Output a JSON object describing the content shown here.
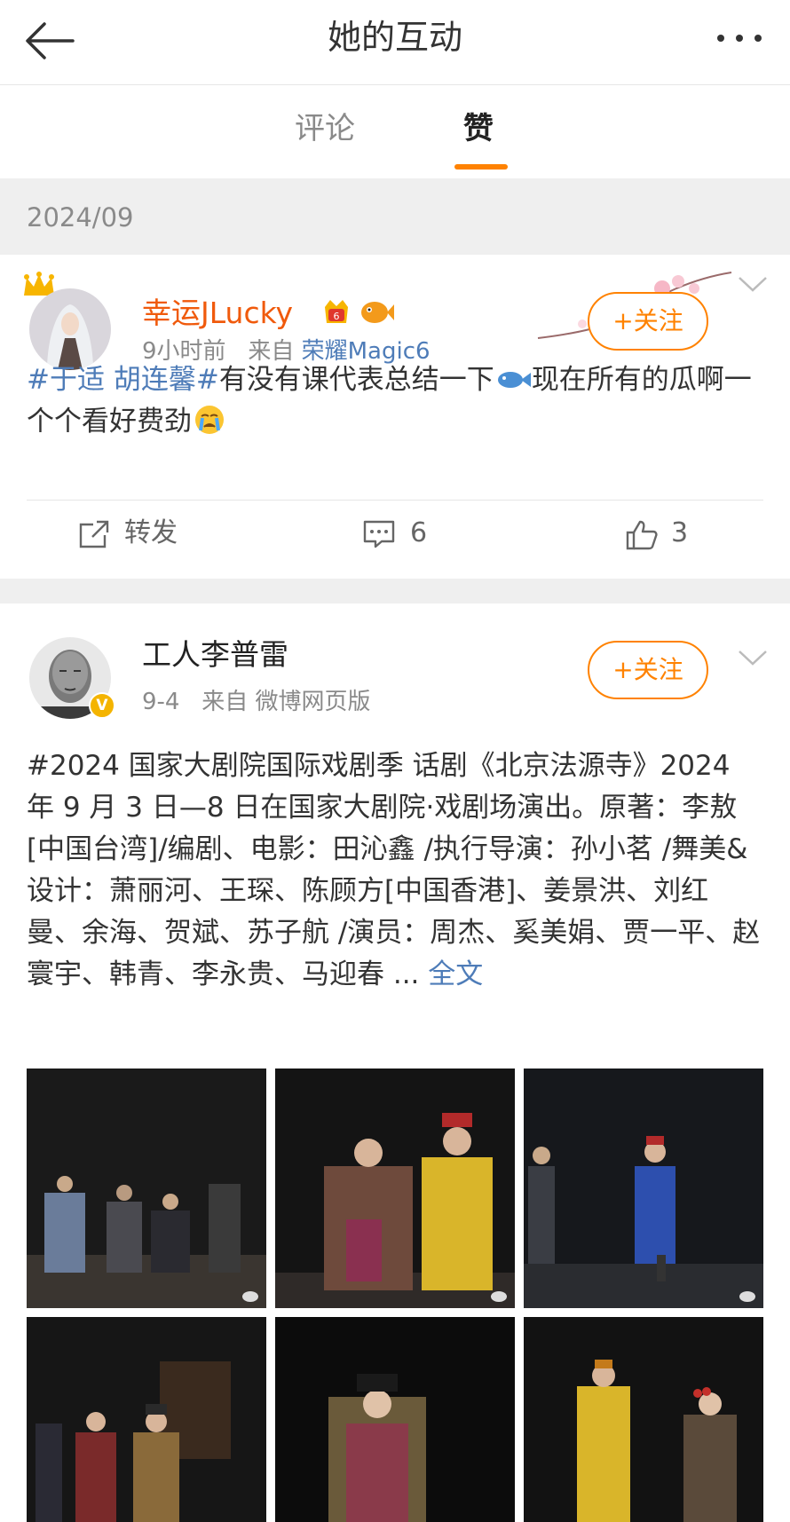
{
  "header": {
    "title": "她的互动"
  },
  "tabs": [
    {
      "label": "评论"
    },
    {
      "label": "赞"
    }
  ],
  "month": "2024/09",
  "posts": [
    {
      "username": "幸运JLucky",
      "time": "9小时前",
      "source_prefix": "来自",
      "device": "荣耀Magic6",
      "follow_label": "+关注",
      "hashtag": "#于适 胡连馨#",
      "text": "有没有课代表总结一下",
      "text2": "现在所有的瓜啊一个个看好费劲",
      "actions": {
        "repost_label": "转发",
        "comment_count": "6",
        "like_count": "3"
      }
    },
    {
      "username": "工人李普雷",
      "time": "9-4",
      "source_prefix": "来自",
      "device": "微博网页版",
      "follow_label": "+关注",
      "body": "#2024 国家大剧院国际戏剧季 话剧《北京法源寺》2024 年 9 月 3 日—8 日在国家大剧院·戏剧场演出。原著：李敖[中国台湾]/编剧、电影：田沁鑫 /执行导演：孙小茗 /舞美&设计：萧丽河、王琛、陈顾方[中国香港]、姜景洪、刘红曼、余海、贺斌、苏子航 /演员：周杰、奚美娟、贾一平、赵寰宇、韩青、李永贵、马迎春 ...",
      "more_label": " 全文"
    }
  ],
  "colors": {
    "accent": "#ff8200",
    "link": "#4e7cb8",
    "username_highlight": "#f05a0c"
  }
}
